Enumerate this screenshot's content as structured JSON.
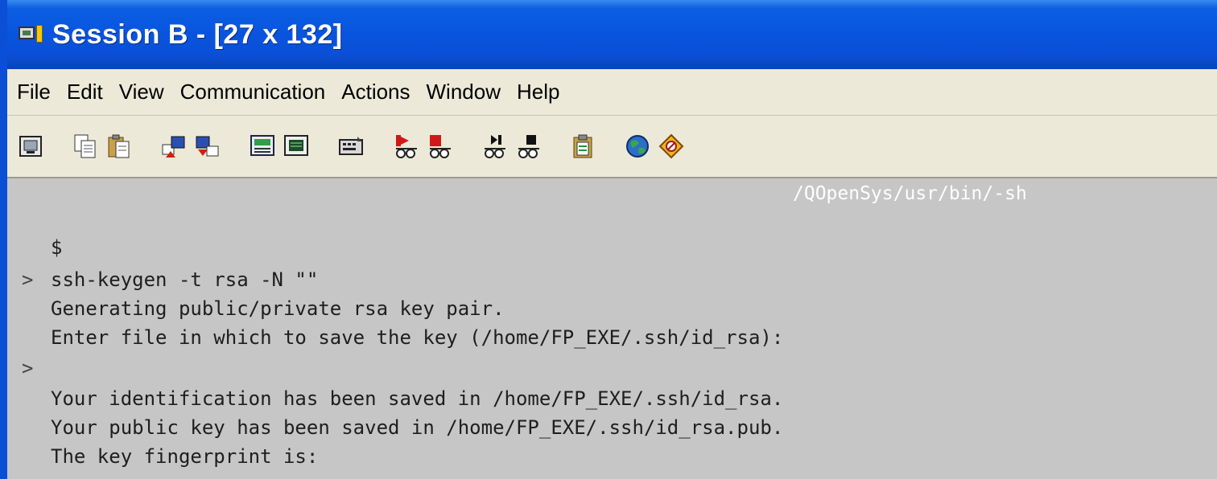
{
  "window": {
    "title": "Session B - [27 x 132]"
  },
  "menu": {
    "items": [
      "File",
      "Edit",
      "View",
      "Communication",
      "Actions",
      "Window",
      "Help"
    ]
  },
  "toolbar": {
    "icons": [
      "print-screen-icon",
      "copy-icon",
      "paste-icon",
      "send-file-icon",
      "receive-file-icon",
      "display-setup-icon",
      "keyboard-map-icon",
      "macro-icon",
      "record-macro-icon",
      "stop-macro-icon",
      "play-macro-icon",
      "macro-pause-icon",
      "clipboard-icon",
      "globe-icon",
      "help-icon"
    ]
  },
  "terminal": {
    "path": "/QOpenSys/usr/bin/-sh",
    "lines": [
      "$",
      "ssh-keygen -t rsa -N \"\"",
      "Generating public/private rsa key pair.",
      "Enter file in which to save the key (/home/FP_EXE/.ssh/id_rsa):",
      "",
      "Your identification has been saved in /home/FP_EXE/.ssh/id_rsa.",
      "Your public key has been saved in /home/FP_EXE/.ssh/id_rsa.pub.",
      "The key fingerprint is:"
    ],
    "prompt_symbol": ">"
  },
  "colors": {
    "titlebar": "#0a4fd6",
    "terminal_bg": "#c6c6c6",
    "path_text": "#ffffff"
  }
}
